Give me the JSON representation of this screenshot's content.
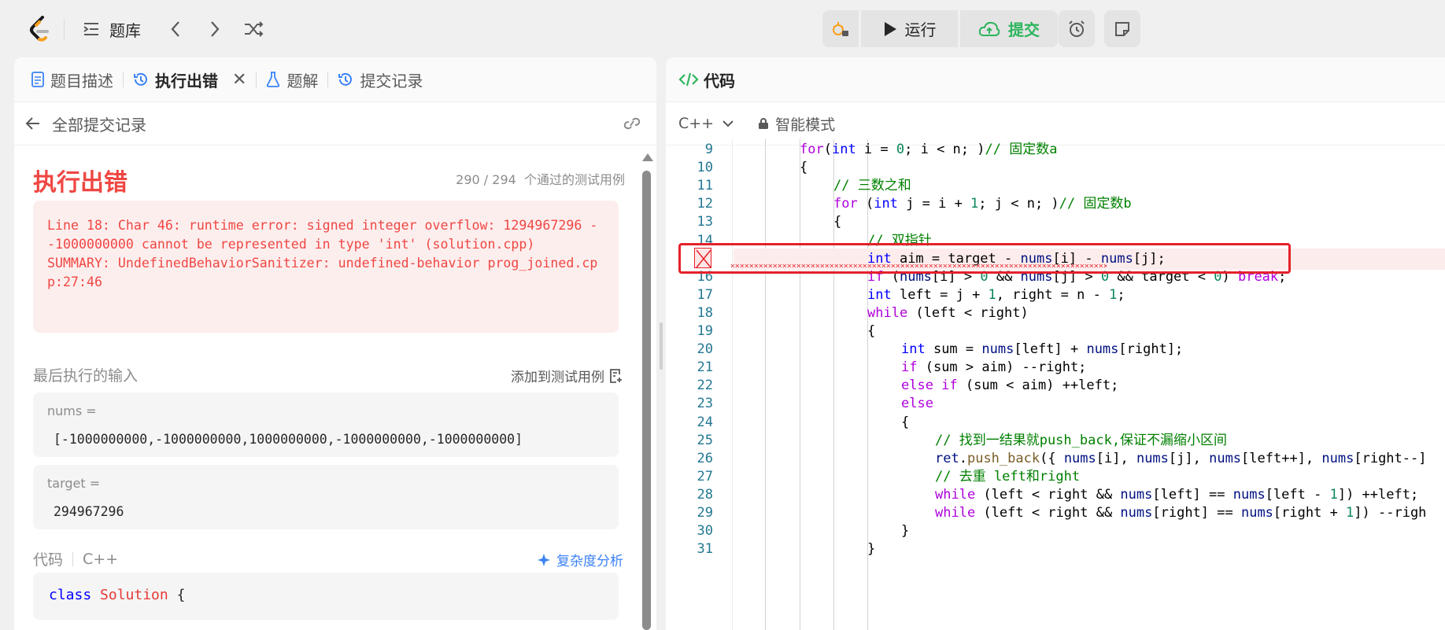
{
  "topbar": {
    "problem_list_label": "题库",
    "run_label": "运行",
    "submit_label": "提交",
    "accent_green": "#2db55d",
    "icons": [
      "logo-icon",
      "list-icon",
      "chevron-left-icon",
      "chevron-right-icon",
      "shuffle-icon",
      "debug-lock-icon",
      "play-icon",
      "cloud-upload-icon",
      "alarm-clock-icon",
      "note-icon"
    ]
  },
  "left": {
    "tabs": [
      {
        "label": "题目描述",
        "icon": "document-icon"
      },
      {
        "label": "执行出错",
        "icon": "history-icon",
        "active": true
      },
      {
        "label": "题解",
        "icon": "flask-icon"
      },
      {
        "label": "提交记录",
        "icon": "history-icon"
      }
    ],
    "tab_close": "✕",
    "back_label": "全部提交记录",
    "result_title": "执行出错",
    "pass_count": "290 / 294",
    "pass_suffix": "个通过的测试用例",
    "error_message": "Line 18: Char 46: runtime error: signed integer overflow: 1294967296 - -1000000000 cannot be represented in type 'int' (solution.cpp)\nSUMMARY: UndefinedBehaviorSanitizer: undefined-behavior prog_joined.cpp:27:46",
    "last_input_label": "最后执行的输入",
    "add_testcase_label": "添加到测试用例",
    "inputs": [
      {
        "name": "nums =",
        "value": "[-1000000000,-1000000000,1000000000,-1000000000,-1000000000]"
      },
      {
        "name": "target =",
        "value": "294967296"
      }
    ],
    "code_label": "代码",
    "code_lang": "C++",
    "complexity_label": "复杂度分析",
    "code_peek_kw": "class",
    "code_peek_name": "Solution",
    "code_peek_brace": "{",
    "error_color": "#ef4743"
  },
  "right": {
    "title": "代码",
    "lang": "C++",
    "mode": "智能模式",
    "error_line": 15,
    "lines": [
      {
        "n": "9",
        "indent": 0,
        "tokens": [
          [
            "c-ctl",
            "for"
          ],
          [
            "",
            "("
          ],
          [
            "c-kw",
            "int"
          ],
          [
            "",
            " i = "
          ],
          [
            "c-num",
            "0"
          ],
          [
            "",
            "; i < n; )"
          ],
          [
            "c-cm",
            "// 固定数a"
          ]
        ]
      },
      {
        "n": "10",
        "indent": 0,
        "tokens": [
          [
            "",
            "{"
          ]
        ]
      },
      {
        "n": "11",
        "indent": 1,
        "tokens": [
          [
            "c-cm",
            "// 三数之和"
          ]
        ]
      },
      {
        "n": "12",
        "indent": 1,
        "tokens": [
          [
            "c-ctl",
            "for"
          ],
          [
            "",
            " ("
          ],
          [
            "c-kw",
            "int"
          ],
          [
            "",
            " j = i + "
          ],
          [
            "c-num",
            "1"
          ],
          [
            "",
            "; j < n; )"
          ],
          [
            "c-cm",
            "// 固定数b"
          ]
        ]
      },
      {
        "n": "13",
        "indent": 1,
        "tokens": [
          [
            "",
            "{"
          ]
        ]
      },
      {
        "n": "14",
        "indent": 2,
        "tokens": [
          [
            "c-cm",
            "// 双指针"
          ]
        ]
      },
      {
        "n": "",
        "indent": 2,
        "tokens": [
          [
            "c-kw",
            "int"
          ],
          [
            "",
            " aim = target - "
          ],
          [
            "c-id",
            "nums"
          ],
          [
            "",
            "[i] - "
          ],
          [
            "c-id",
            "nums"
          ],
          [
            "",
            "[j];"
          ]
        ]
      },
      {
        "n": "16",
        "indent": 2,
        "tokens": [
          [
            "c-ctl",
            "if"
          ],
          [
            "",
            " ("
          ],
          [
            "c-id",
            "nums"
          ],
          [
            "",
            "[i] > "
          ],
          [
            "c-num",
            "0"
          ],
          [
            "",
            " && "
          ],
          [
            "c-id",
            "nums"
          ],
          [
            "",
            "[j] > "
          ],
          [
            "c-num",
            "0"
          ],
          [
            "",
            " && target < "
          ],
          [
            "c-num",
            "0"
          ],
          [
            "",
            ") "
          ],
          [
            "c-ctl",
            "break"
          ],
          [
            "",
            ";"
          ]
        ]
      },
      {
        "n": "17",
        "indent": 2,
        "tokens": [
          [
            "c-kw",
            "int"
          ],
          [
            "",
            " left = j + "
          ],
          [
            "c-num",
            "1"
          ],
          [
            "",
            ", right = n - "
          ],
          [
            "c-num",
            "1"
          ],
          [
            "",
            ";"
          ]
        ]
      },
      {
        "n": "18",
        "indent": 2,
        "tokens": [
          [
            "c-ctl",
            "while"
          ],
          [
            "",
            " (left < right)"
          ]
        ]
      },
      {
        "n": "19",
        "indent": 2,
        "tokens": [
          [
            "",
            "{"
          ]
        ]
      },
      {
        "n": "20",
        "indent": 3,
        "tokens": [
          [
            "c-kw",
            "int"
          ],
          [
            "",
            " sum = "
          ],
          [
            "c-id",
            "nums"
          ],
          [
            "",
            "[left] + "
          ],
          [
            "c-id",
            "nums"
          ],
          [
            "",
            "[right];"
          ]
        ]
      },
      {
        "n": "21",
        "indent": 3,
        "tokens": [
          [
            "c-ctl",
            "if"
          ],
          [
            "",
            " (sum > aim) --right;"
          ]
        ]
      },
      {
        "n": "22",
        "indent": 3,
        "tokens": [
          [
            "c-ctl",
            "else if"
          ],
          [
            "",
            " (sum < aim) ++left;"
          ]
        ]
      },
      {
        "n": "23",
        "indent": 3,
        "tokens": [
          [
            "c-ctl",
            "else"
          ]
        ]
      },
      {
        "n": "24",
        "indent": 3,
        "tokens": [
          [
            "",
            "{"
          ]
        ]
      },
      {
        "n": "25",
        "indent": 4,
        "tokens": [
          [
            "c-cm",
            "// 找到一结果就push_back,保证不漏缩小区间"
          ]
        ]
      },
      {
        "n": "26",
        "indent": 4,
        "tokens": [
          [
            "c-id",
            "ret"
          ],
          [
            "",
            "."
          ],
          [
            "c-fn",
            "push_back"
          ],
          [
            "",
            "({ "
          ],
          [
            "c-id",
            "nums"
          ],
          [
            "",
            "[i], "
          ],
          [
            "c-id",
            "nums"
          ],
          [
            "",
            "[j], "
          ],
          [
            "c-id",
            "nums"
          ],
          [
            "",
            "[left++], "
          ],
          [
            "c-id",
            "nums"
          ],
          [
            "",
            "[right--]"
          ]
        ]
      },
      {
        "n": "27",
        "indent": 4,
        "tokens": [
          [
            "c-cm",
            "// 去重 left和right"
          ]
        ]
      },
      {
        "n": "28",
        "indent": 4,
        "tokens": [
          [
            "c-ctl",
            "while"
          ],
          [
            "",
            " (left < right && "
          ],
          [
            "c-id",
            "nums"
          ],
          [
            "",
            "[left] == "
          ],
          [
            "c-id",
            "nums"
          ],
          [
            "",
            "[left - "
          ],
          [
            "c-num",
            "1"
          ],
          [
            "",
            "]) ++left;"
          ]
        ]
      },
      {
        "n": "29",
        "indent": 4,
        "tokens": [
          [
            "c-ctl",
            "while"
          ],
          [
            "",
            " (left < right && "
          ],
          [
            "c-id",
            "nums"
          ],
          [
            "",
            "[right] == "
          ],
          [
            "c-id",
            "nums"
          ],
          [
            "",
            "[right + "
          ],
          [
            "c-num",
            "1"
          ],
          [
            "",
            "]) --righ"
          ]
        ]
      },
      {
        "n": "30",
        "indent": 3,
        "tokens": [
          [
            "",
            "}"
          ]
        ]
      },
      {
        "n": "31",
        "indent": 2,
        "tokens": [
          [
            "",
            "}"
          ]
        ]
      }
    ]
  }
}
